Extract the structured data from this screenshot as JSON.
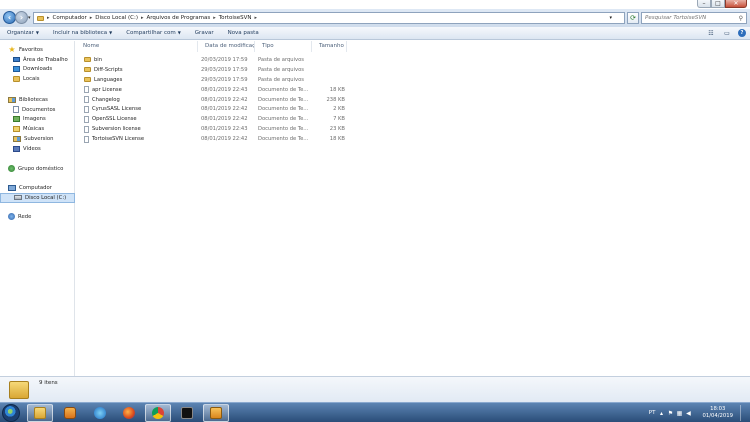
{
  "window": {
    "controls": {
      "minimize": "–",
      "maximize": "□",
      "close": "✕"
    }
  },
  "address": {
    "path": [
      "Computador",
      "Disco Local (C:)",
      "Arquivos de Programas",
      "TortoiseSVN"
    ],
    "search_placeholder": "Pesquisar TortoiseSVN"
  },
  "toolbar": {
    "items": [
      "Organizar",
      "Incluir na biblioteca",
      "Compartilhar com",
      "Gravar",
      "Nova pasta"
    ]
  },
  "nav": {
    "favorites": {
      "label": "Favoritos",
      "items": [
        "Área de Trabalho",
        "Downloads",
        "Locais"
      ]
    },
    "libraries": {
      "label": "Bibliotecas",
      "items": [
        "Documentos",
        "Imagens",
        "Músicas",
        "Subversion",
        "Vídeos"
      ]
    },
    "homegroup": {
      "label": "Grupo doméstico"
    },
    "computer": {
      "label": "Computador",
      "items": [
        "Disco Local (C:)"
      ]
    },
    "network": {
      "label": "Rede"
    }
  },
  "columns": {
    "name": "Nome",
    "date": "Data de modificaç...",
    "type": "Tipo",
    "size": "Tamanho"
  },
  "files": [
    {
      "name": "bin",
      "date": "20/03/2019 17:59",
      "type": "Pasta de arquivos",
      "size": "",
      "kind": "folder"
    },
    {
      "name": "Diff-Scripts",
      "date": "29/03/2019 17:59",
      "type": "Pasta de arquivos",
      "size": "",
      "kind": "folder"
    },
    {
      "name": "Languages",
      "date": "29/03/2019 17:59",
      "type": "Pasta de arquivos",
      "size": "",
      "kind": "folder"
    },
    {
      "name": "apr License",
      "date": "08/01/2019 22:43",
      "type": "Documento de Te...",
      "size": "18 KB",
      "kind": "file"
    },
    {
      "name": "Changelog",
      "date": "08/01/2019 22:42",
      "type": "Documento de Te...",
      "size": "238 KB",
      "kind": "file"
    },
    {
      "name": "CyrusSASL License",
      "date": "08/01/2019 22:42",
      "type": "Documento de Te...",
      "size": "2 KB",
      "kind": "file"
    },
    {
      "name": "OpenSSL License",
      "date": "08/01/2019 22:42",
      "type": "Documento de Te...",
      "size": "7 KB",
      "kind": "file"
    },
    {
      "name": "Subversion license",
      "date": "08/01/2019 22:43",
      "type": "Documento de Te...",
      "size": "23 KB",
      "kind": "file"
    },
    {
      "name": "TortoiseSVN License",
      "date": "08/01/2019 22:42",
      "type": "Documento de Te...",
      "size": "18 KB",
      "kind": "file"
    }
  ],
  "details": {
    "count": "9 itens"
  },
  "taskbar": {
    "lang": "PT",
    "time": "18:03",
    "date": "01/04/2019"
  }
}
